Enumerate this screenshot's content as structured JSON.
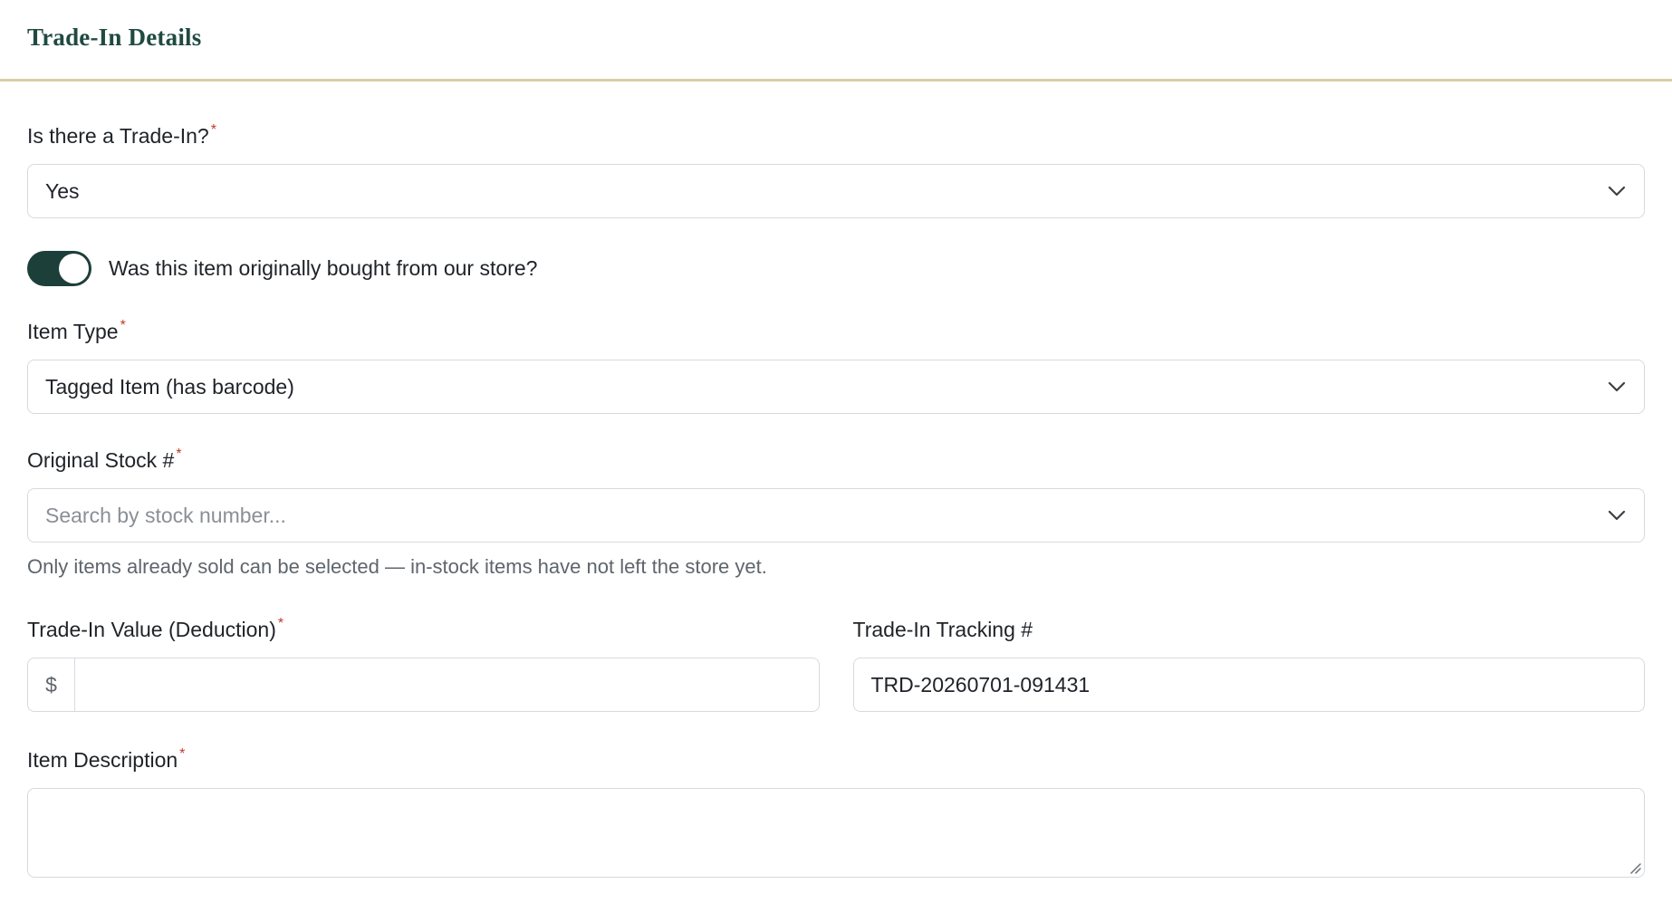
{
  "header": {
    "title": "Trade-In Details"
  },
  "fields": {
    "trade_in": {
      "label": "Is there a Trade-In?",
      "required_mark": "*",
      "value": "Yes"
    },
    "bought_from_store": {
      "label": "Was this item originally bought from our store?",
      "checked": true
    },
    "item_type": {
      "label": "Item Type",
      "required_mark": "*",
      "value": "Tagged Item (has barcode)"
    },
    "original_stock": {
      "label": "Original Stock #",
      "required_mark": "*",
      "placeholder": "Search by stock number...",
      "help": "Only items already sold can be selected — in-stock items have not left the store yet."
    },
    "trade_in_value": {
      "label": "Trade-In Value (Deduction)",
      "required_mark": "*",
      "prefix": "$",
      "value": ""
    },
    "tracking": {
      "label": "Trade-In Tracking #",
      "value": "TRD-20260701-091431"
    },
    "item_description": {
      "label": "Item Description",
      "required_mark": "*",
      "value": ""
    }
  },
  "colors": {
    "accent": "#1d3f3a",
    "title": "#1f4a42",
    "divider": "#d9cfa4",
    "required": "#c0392b"
  }
}
